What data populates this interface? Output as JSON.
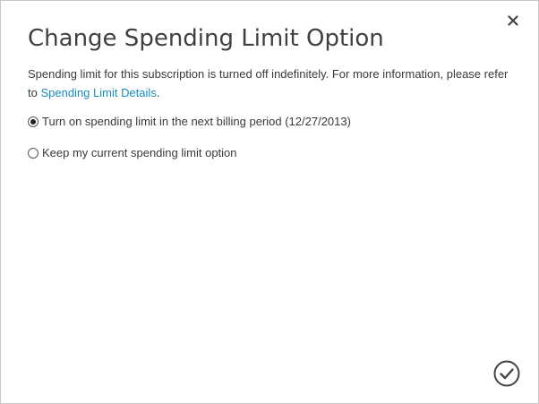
{
  "dialog": {
    "title": "Change Spending Limit Option",
    "description_text": "Spending limit for this subscription is turned off indefinitely. For more information, please refer to ",
    "description_link": "Spending Limit Details",
    "description_end": ".",
    "options": [
      {
        "label": "Turn on spending limit in the next billing period (12/27/2013)",
        "selected": true
      },
      {
        "label": "Keep my current spending limit option",
        "selected": false
      }
    ],
    "close_icon": "close-icon",
    "confirm_icon": "checkmark-circle-icon"
  },
  "colors": {
    "link": "#1a8bc0",
    "title": "#404040",
    "text": "#3a3a3a",
    "border": "#c8c8c8"
  }
}
